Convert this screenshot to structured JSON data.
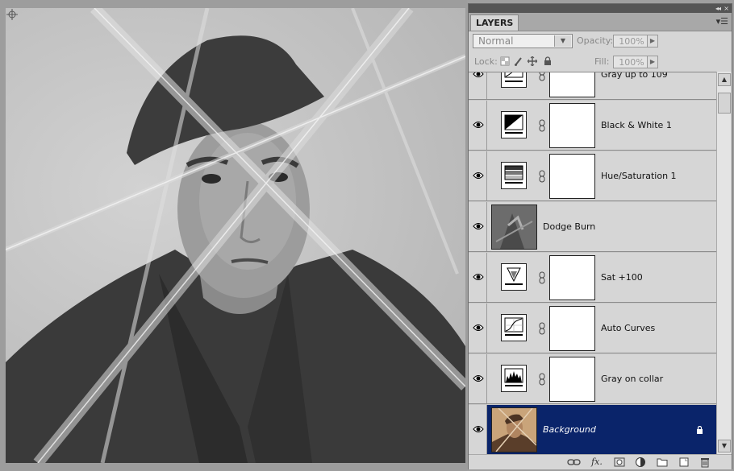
{
  "panel": {
    "tab": "LAYERS",
    "collapse_icon": "double-chevron-right-icon",
    "menu_icon": "panel-menu-icon"
  },
  "options": {
    "blend_mode": "Normal",
    "opacity_label": "Opacity:",
    "opacity_value": "100%",
    "lock_label": "Lock:",
    "fill_label": "Fill:",
    "fill_value": "100%"
  },
  "layers": [
    {
      "name": "Gray up to 109",
      "type": "adjustment",
      "icon": "curves-icon",
      "visible": true,
      "partially_visible": true
    },
    {
      "name": "Black & White 1",
      "type": "adjustment",
      "icon": "black-white-icon",
      "visible": true
    },
    {
      "name": "Hue/Saturation 1",
      "type": "adjustment",
      "icon": "hue-saturation-icon",
      "visible": true
    },
    {
      "name": "Dodge Burn",
      "type": "pixel",
      "icon": "pixel-thumbnail",
      "visible": true
    },
    {
      "name": "Sat +100",
      "type": "adjustment",
      "icon": "vibrance-icon",
      "visible": true
    },
    {
      "name": "Auto Curves",
      "type": "adjustment",
      "icon": "curves-icon",
      "visible": true
    },
    {
      "name": "Gray on collar",
      "type": "adjustment",
      "icon": "levels-icon",
      "visible": true
    },
    {
      "name": "Background",
      "type": "pixel",
      "icon": "photo-thumbnail",
      "visible": true,
      "selected": true,
      "locked": true
    }
  ],
  "bottom_bar": [
    "link-layers-icon",
    "fx-icon",
    "add-mask-icon",
    "new-adjustment-icon",
    "new-group-icon",
    "new-layer-icon",
    "delete-icon"
  ],
  "colors": {
    "selection": "#0a246a",
    "panel_bg": "#d6d6d6",
    "canvas_bg": "#9d9d9d"
  }
}
